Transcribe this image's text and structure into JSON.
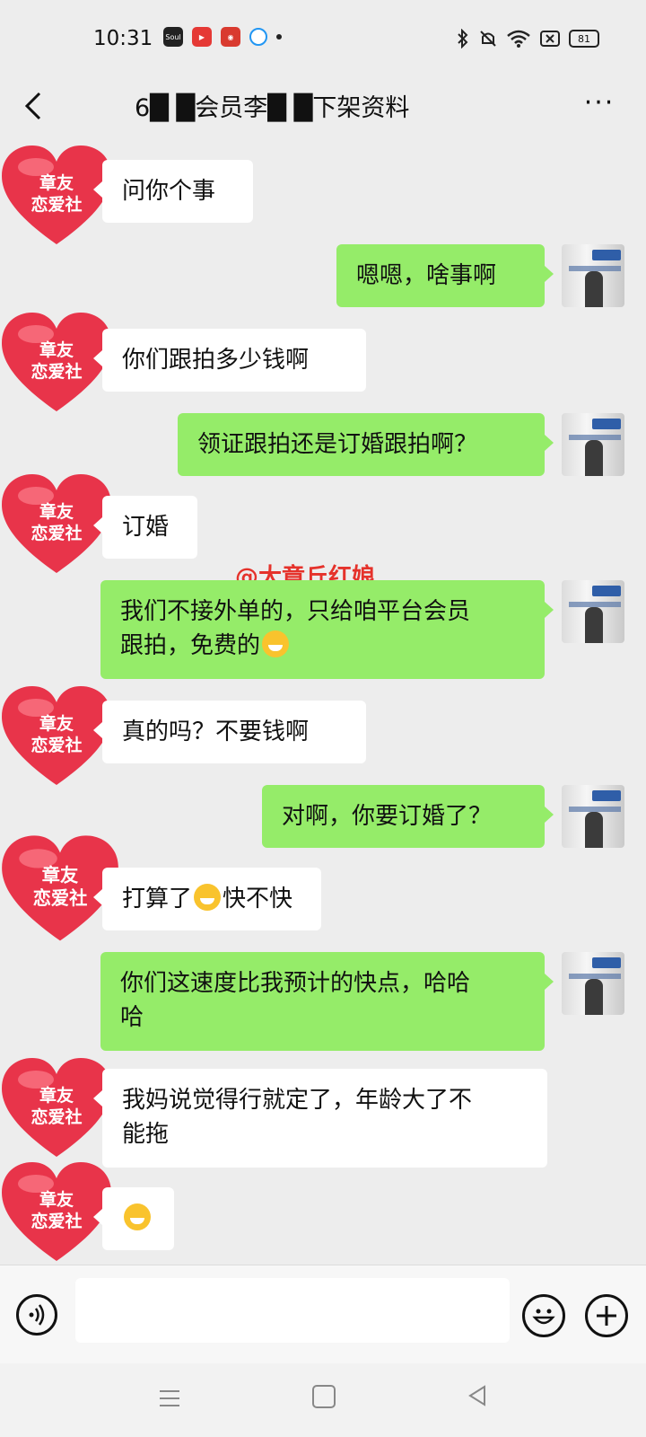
{
  "status_bar": {
    "time": "10:31",
    "app_icons": [
      "Soul",
      "video-app-icon",
      "red-app-icon",
      "blue-app-icon"
    ],
    "battery": "81",
    "icons": [
      "bluetooth-icon",
      "mute-icon",
      "wifi-icon",
      "close-box-icon",
      "battery-icon"
    ]
  },
  "header": {
    "title": "6█ █会员李█ █下架资料",
    "more": "···"
  },
  "avatar_text": {
    "line1": "章友",
    "line2": "恋爱社"
  },
  "messages": [
    {
      "side": "left",
      "text": "问你个事"
    },
    {
      "side": "right",
      "text": "嗯嗯，啥事啊"
    },
    {
      "side": "left",
      "text": "你们跟拍多少钱啊"
    },
    {
      "side": "right",
      "text": "领证跟拍还是订婚跟拍啊？"
    },
    {
      "side": "left",
      "text": "订婚"
    },
    {
      "side": "right",
      "text_line1": "我们不接外单的，只给咱平台会员",
      "text_line2": "跟拍，免费的",
      "emoji": "grin-emoji"
    },
    {
      "side": "left",
      "text": "真的吗？不要钱啊"
    },
    {
      "side": "right",
      "text": "对啊，你要订婚了？"
    },
    {
      "side": "left",
      "text_a": "打算了",
      "emoji": "facepalm-emoji",
      "text_b": "快不快"
    },
    {
      "side": "right",
      "text_line1": "你们这速度比我预计的快点，哈哈",
      "text_line2": "哈"
    },
    {
      "side": "left",
      "text_line1": "我妈说觉得行就定了，年龄大了不",
      "text_line2": "能拖"
    },
    {
      "side": "left",
      "emoji": "crying-emoji"
    }
  ],
  "watermark": "@大章丘红娘",
  "input_bar": {
    "placeholder": ""
  },
  "colors": {
    "bubble_right": "#95ec69",
    "bubble_left": "#ffffff",
    "background": "#ededed",
    "heart": "#e8344a"
  }
}
